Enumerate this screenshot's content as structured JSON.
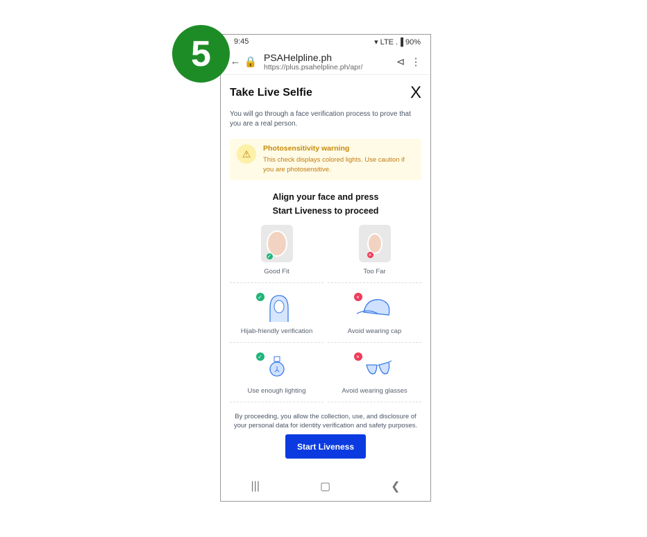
{
  "step_badge": "5",
  "status": {
    "time": "9:45",
    "icons": "▾ LTE .▐",
    "battery": "90%"
  },
  "browser": {
    "site_title": "PSAHelpline.ph",
    "url": "https://plus.psahelpline.ph/apr/"
  },
  "page": {
    "title": "Take Live Selfie",
    "close": "X",
    "description": "You will go through a face verification process to prove that you are a real person.",
    "warning": {
      "title": "Photosensitivity warning",
      "text": "This check displays colored lights. Use caution if you are photosensitive."
    },
    "align_line1": "Align your face and press",
    "align_line2": "Start Liveness to proceed",
    "tips": [
      {
        "label": "Good Fit",
        "status": "ok"
      },
      {
        "label": "Too Far",
        "status": "no"
      },
      {
        "label": "Hijab-friendly verification",
        "status": "ok"
      },
      {
        "label": "Avoid wearing cap",
        "status": "no"
      },
      {
        "label": "Use enough lighting",
        "status": "ok"
      },
      {
        "label": "Avoid wearing glasses",
        "status": "no"
      }
    ],
    "legal": "By proceeding, you allow the collection, use, and disclosure of your personal data for identity verification and safety purposes.",
    "start_button": "Start Liveness"
  },
  "colors": {
    "accent": "#0b3be0",
    "badge": "#1e8c26",
    "ok": "#1fb57a",
    "no": "#ef3b5a",
    "warning_bg": "#fffbe6"
  }
}
